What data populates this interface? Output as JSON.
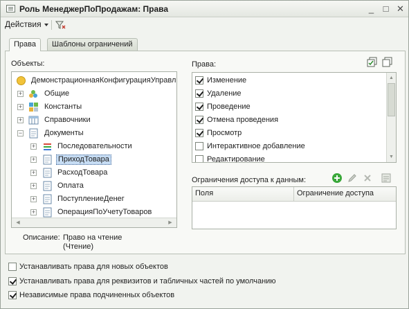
{
  "window": {
    "title": "Роль МенеджерПоПродажам: Права",
    "controls": {
      "minimize": "_",
      "maximize": "□",
      "close": "✕"
    }
  },
  "toolbar": {
    "actions_label": "Действия",
    "filter_icon": "filter-icon"
  },
  "tabs": [
    {
      "label": "Права",
      "active": true
    },
    {
      "label": "Шаблоны ограничений",
      "active": false
    }
  ],
  "objects": {
    "label": "Объекты:",
    "tree": [
      {
        "label": "ДемонстрационнаяКонфигурацияУправл",
        "icon": "configuration-icon",
        "level": 0,
        "expander": ""
      },
      {
        "label": "Общие",
        "icon": "common-icon",
        "level": 1,
        "expander": "+"
      },
      {
        "label": "Константы",
        "icon": "constants-icon",
        "level": 1,
        "expander": "+"
      },
      {
        "label": "Справочники",
        "icon": "catalogs-icon",
        "level": 1,
        "expander": "+"
      },
      {
        "label": "Документы",
        "icon": "documents-icon",
        "level": 1,
        "expander": "−"
      },
      {
        "label": "Последовательности",
        "icon": "sequences-icon",
        "level": 2,
        "expander": "+"
      },
      {
        "label": "ПриходТовара",
        "icon": "document-icon",
        "level": 2,
        "expander": "+",
        "selected": true
      },
      {
        "label": "РасходТовара",
        "icon": "document-icon",
        "level": 2,
        "expander": "+"
      },
      {
        "label": "Оплата",
        "icon": "document-icon",
        "level": 2,
        "expander": "+"
      },
      {
        "label": "ПоступлениеДенег",
        "icon": "document-icon",
        "level": 2,
        "expander": "+"
      },
      {
        "label": "ОперацияПоУчетуТоваров",
        "icon": "document-icon",
        "level": 2,
        "expander": "+"
      }
    ]
  },
  "description": {
    "label": "Описание:",
    "line1": "Право на чтение",
    "line2": "(Чтение)"
  },
  "rights": {
    "label": "Права:",
    "items": [
      {
        "label": "Изменение",
        "checked": true
      },
      {
        "label": "Удаление",
        "checked": true
      },
      {
        "label": "Проведение",
        "checked": true
      },
      {
        "label": "Отмена проведения",
        "checked": true
      },
      {
        "label": "Просмотр",
        "checked": true
      },
      {
        "label": "Интерактивное добавление",
        "checked": false
      },
      {
        "label": "Редактирование",
        "checked": false
      }
    ]
  },
  "restrictions": {
    "label": "Ограничения доступа к данным:",
    "columns": [
      "Поля",
      "Ограничение доступа"
    ],
    "rows": []
  },
  "options": [
    {
      "label": "Устанавливать права для новых объектов",
      "checked": false
    },
    {
      "label": "Устанавливать права для реквизитов и табличных частей по умолчанию",
      "checked": true
    },
    {
      "label": "Независимые права подчиненных объектов",
      "checked": true
    }
  ],
  "colors": {
    "window_bg": "#f1f3ef",
    "selection": "#c6dcf3",
    "add_green": "#3aa83a"
  }
}
